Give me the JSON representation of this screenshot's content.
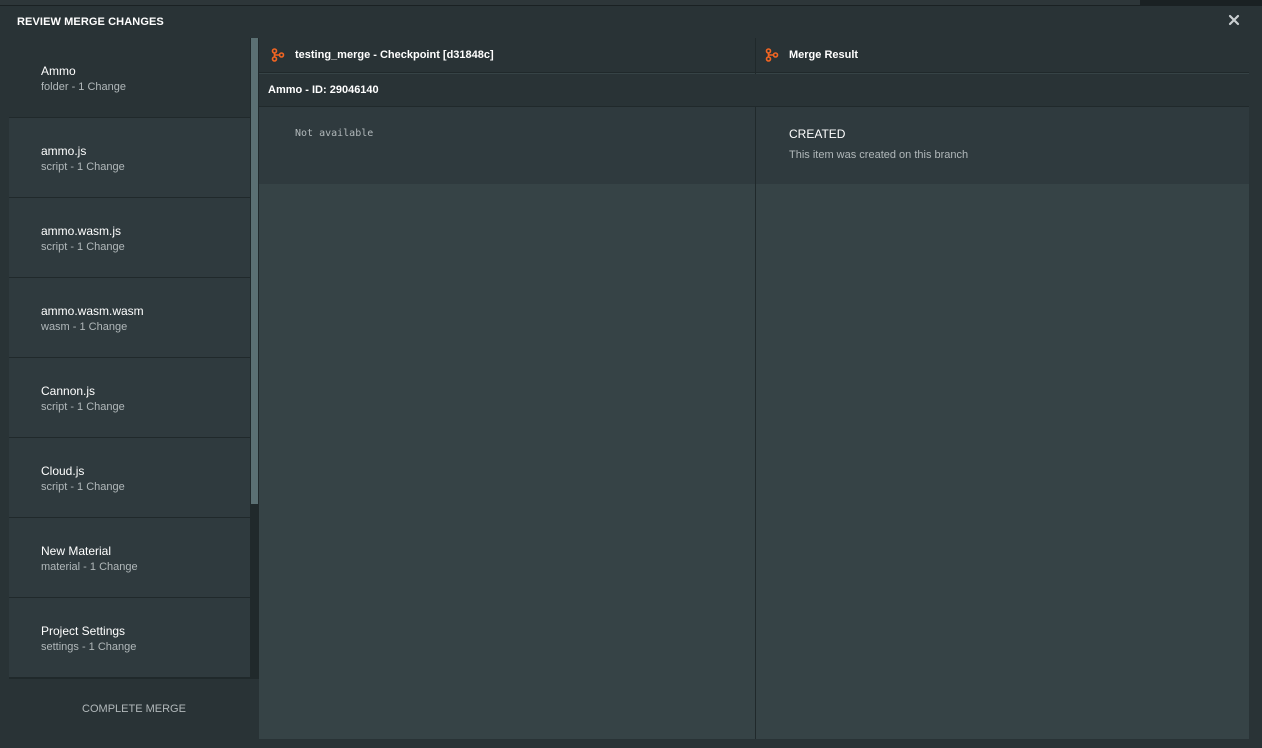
{
  "modal": {
    "title": "REVIEW MERGE CHANGES"
  },
  "sidebar": {
    "items": [
      {
        "name": "Ammo",
        "sub": "folder - 1 Change"
      },
      {
        "name": "ammo.js",
        "sub": "script - 1 Change"
      },
      {
        "name": "ammo.wasm.js",
        "sub": "script - 1 Change"
      },
      {
        "name": "ammo.wasm.wasm",
        "sub": "wasm - 1 Change"
      },
      {
        "name": "Cannon.js",
        "sub": "script - 1 Change"
      },
      {
        "name": "Cloud.js",
        "sub": "script - 1 Change"
      },
      {
        "name": "New Material",
        "sub": "material - 1 Change"
      },
      {
        "name": "Project Settings",
        "sub": "settings - 1 Change"
      }
    ],
    "selected_index": 0,
    "complete_label": "COMPLETE MERGE"
  },
  "columns": {
    "left_title": "testing_merge - Checkpoint [d31848c]",
    "right_title": "Merge Result"
  },
  "item": {
    "label": "Ammo - ID: 29046140"
  },
  "left_content": {
    "text": "Not available"
  },
  "right_content": {
    "status": "CREATED",
    "description": "This item was created on this branch"
  },
  "colors": {
    "accent": "#f26522",
    "background": "#364346",
    "header": "#293336"
  },
  "icons": {
    "close": "close-icon",
    "branch": "branch-icon"
  }
}
